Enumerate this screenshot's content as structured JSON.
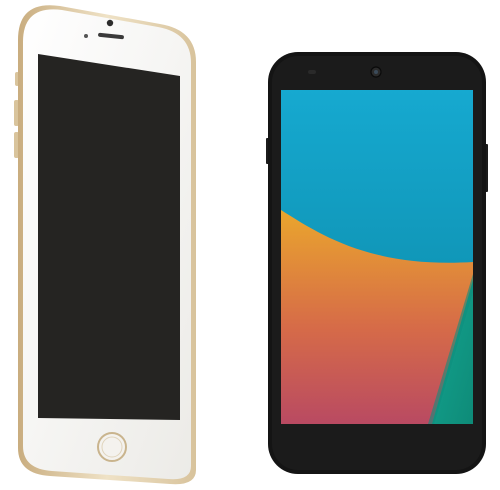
{
  "scene": {
    "background_color": "#ffffff",
    "devices": [
      {
        "kind": "white-and-gold-smartphone",
        "position": "left",
        "frame_color": "#f7f6f3",
        "rim_color": "#e2d2b2",
        "screen_color": "#252422",
        "screen_state": "off"
      },
      {
        "kind": "black-android-smartphone",
        "position": "right",
        "frame_color": "#141414",
        "screen_state": "on",
        "wallpaper_colors": {
          "sky_top": "#16a9d0",
          "sky_bottom": "#0b86a3",
          "wave_top": "#eaa62d",
          "wave_bottom": "#b94a62",
          "teal_panel": "#14a08a"
        }
      }
    ]
  }
}
